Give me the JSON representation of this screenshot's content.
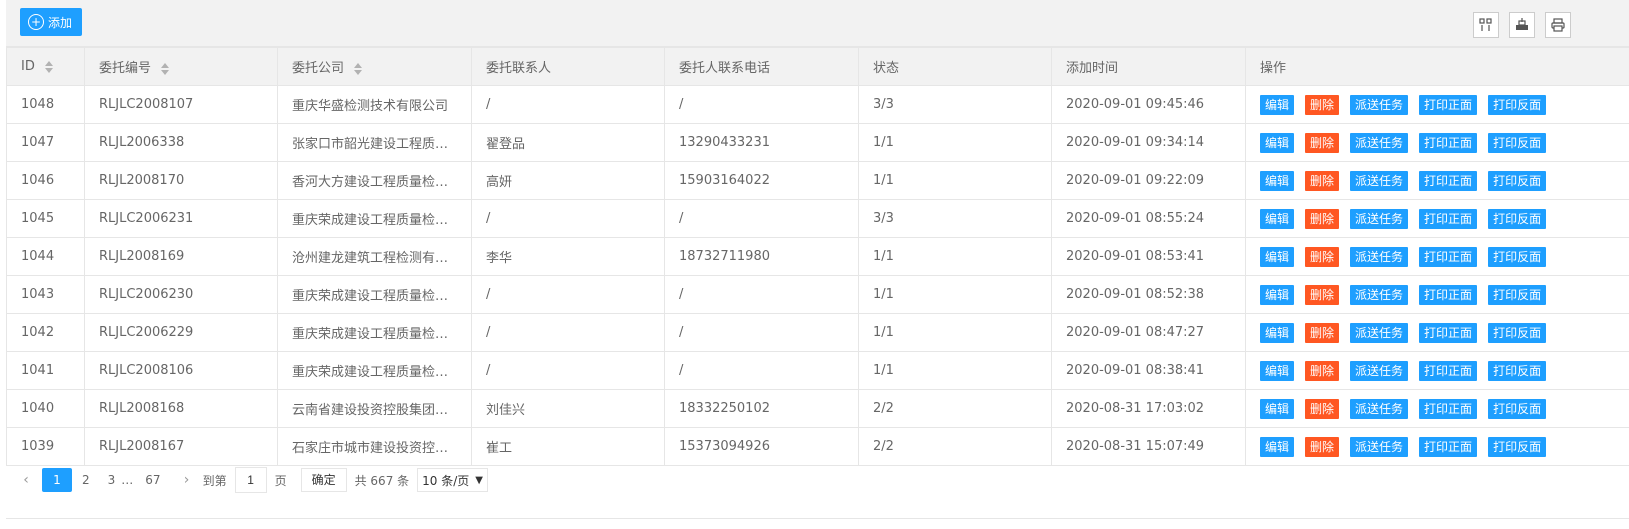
{
  "toolbar": {
    "add_label": "添加",
    "icons": [
      "columns-icon",
      "export-icon",
      "print-icon"
    ]
  },
  "table": {
    "headers": [
      "ID",
      "委托编号",
      "委托公司",
      "委托联系人",
      "委托人联系电话",
      "状态",
      "添加时间",
      "操作"
    ],
    "actions": {
      "edit": "编辑",
      "delete": "删除",
      "dispatch": "派送任务",
      "print_front": "打印正面",
      "print_back": "打印反面"
    },
    "rows": [
      {
        "id": "1048",
        "code": "RLJLC2008107",
        "company": "重庆华盛检测技术有限公司",
        "contact": "/",
        "phone": "/",
        "status": "3/3",
        "time": "2020-09-01 09:45:46"
      },
      {
        "id": "1047",
        "code": "RLJL2006338",
        "company": "张家口市韶光建设工程质…",
        "contact": "翟登品",
        "phone": "13290433231",
        "status": "1/1",
        "time": "2020-09-01 09:34:14"
      },
      {
        "id": "1046",
        "code": "RLJL2008170",
        "company": "香河大方建设工程质量检…",
        "contact": "高妍",
        "phone": "15903164022",
        "status": "1/1",
        "time": "2020-09-01 09:22:09"
      },
      {
        "id": "1045",
        "code": "RLJLC2006231",
        "company": "重庆荣成建设工程质量检…",
        "contact": "/",
        "phone": "/",
        "status": "3/3",
        "time": "2020-09-01 08:55:24"
      },
      {
        "id": "1044",
        "code": "RLJL2008169",
        "company": "沧州建龙建筑工程检测有…",
        "contact": "李华",
        "phone": "18732711980",
        "status": "1/1",
        "time": "2020-09-01 08:53:41"
      },
      {
        "id": "1043",
        "code": "RLJLC2006230",
        "company": "重庆荣成建设工程质量检…",
        "contact": "/",
        "phone": "/",
        "status": "1/1",
        "time": "2020-09-01 08:52:38"
      },
      {
        "id": "1042",
        "code": "RLJLC2006229",
        "company": "重庆荣成建设工程质量检…",
        "contact": "/",
        "phone": "/",
        "status": "1/1",
        "time": "2020-09-01 08:47:27"
      },
      {
        "id": "1041",
        "code": "RLJLC2008106",
        "company": "重庆荣成建设工程质量检…",
        "contact": "/",
        "phone": "/",
        "status": "1/1",
        "time": "2020-09-01 08:38:41"
      },
      {
        "id": "1040",
        "code": "RLJL2008168",
        "company": "云南省建设投资控股集团…",
        "contact": "刘佳兴",
        "phone": "18332250102",
        "status": "2/2",
        "time": "2020-08-31 17:03:02"
      },
      {
        "id": "1039",
        "code": "RLJL2008167",
        "company": "石家庄市城市建设投资控…",
        "contact": "崔工",
        "phone": "15373094926",
        "status": "2/2",
        "time": "2020-08-31 15:07:49"
      }
    ]
  },
  "pager": {
    "pages": [
      "1",
      "2",
      "3",
      "…",
      "67"
    ],
    "current": "1",
    "goto_prefix": "到第",
    "goto_value": "1",
    "goto_suffix": "页",
    "confirm_label": "确定",
    "total_label": "共 667 条",
    "page_size": "10 条/页"
  },
  "colors": {
    "primary": "#1e9fff",
    "danger": "#ff5722",
    "header_bg": "#f2f2f2",
    "border": "#e6e6e6"
  }
}
